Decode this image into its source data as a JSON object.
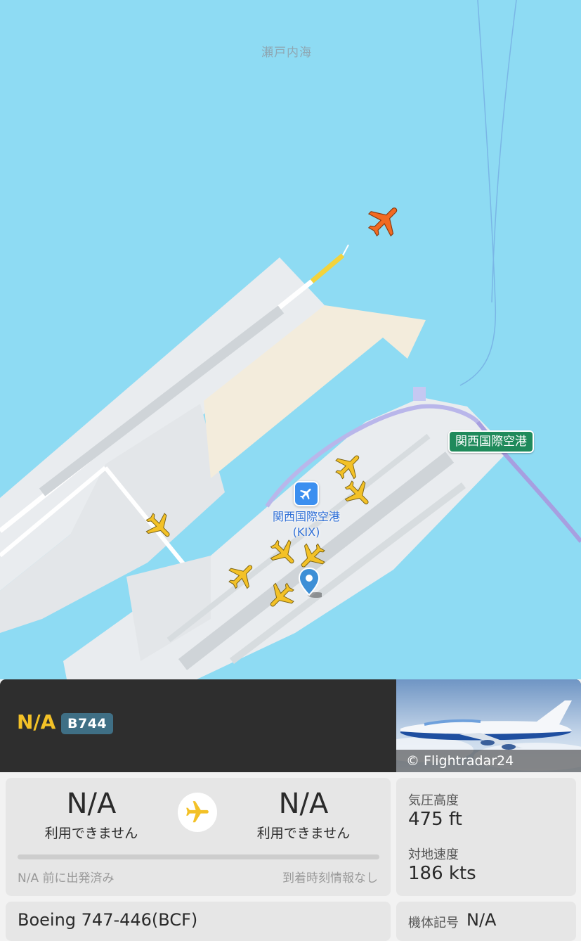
{
  "map": {
    "sea_label": "瀬戸内海",
    "airport_name": "関西国際空港",
    "airport_code": "(KIX)",
    "station_label": "関西国際空港",
    "colors": {
      "water": "#8edbf3",
      "land": "#e9ecef",
      "apron": "#f3ecdc",
      "runway": "#ffffff",
      "selected_plane": "#f26a21",
      "other_planes": "#f3c127"
    }
  },
  "flight": {
    "callsign": "N/A",
    "type_code": "B744",
    "photo_credit": "© Flightradar24"
  },
  "route": {
    "origin_code": "N/A",
    "origin_status": "利用できません",
    "destination_code": "N/A",
    "destination_status": "利用できません",
    "departed_text": "N/A 前に出発済み",
    "arrival_text": "到着時刻情報なし",
    "progress": 0.0
  },
  "stats": {
    "altitude_label": "気圧高度",
    "altitude_value": "475 ft",
    "speed_label": "対地速度",
    "speed_value": "186 kts"
  },
  "aircraft": {
    "model": "Boeing 747-446(BCF)",
    "registration_label": "機体記号",
    "registration_value": "N/A"
  }
}
